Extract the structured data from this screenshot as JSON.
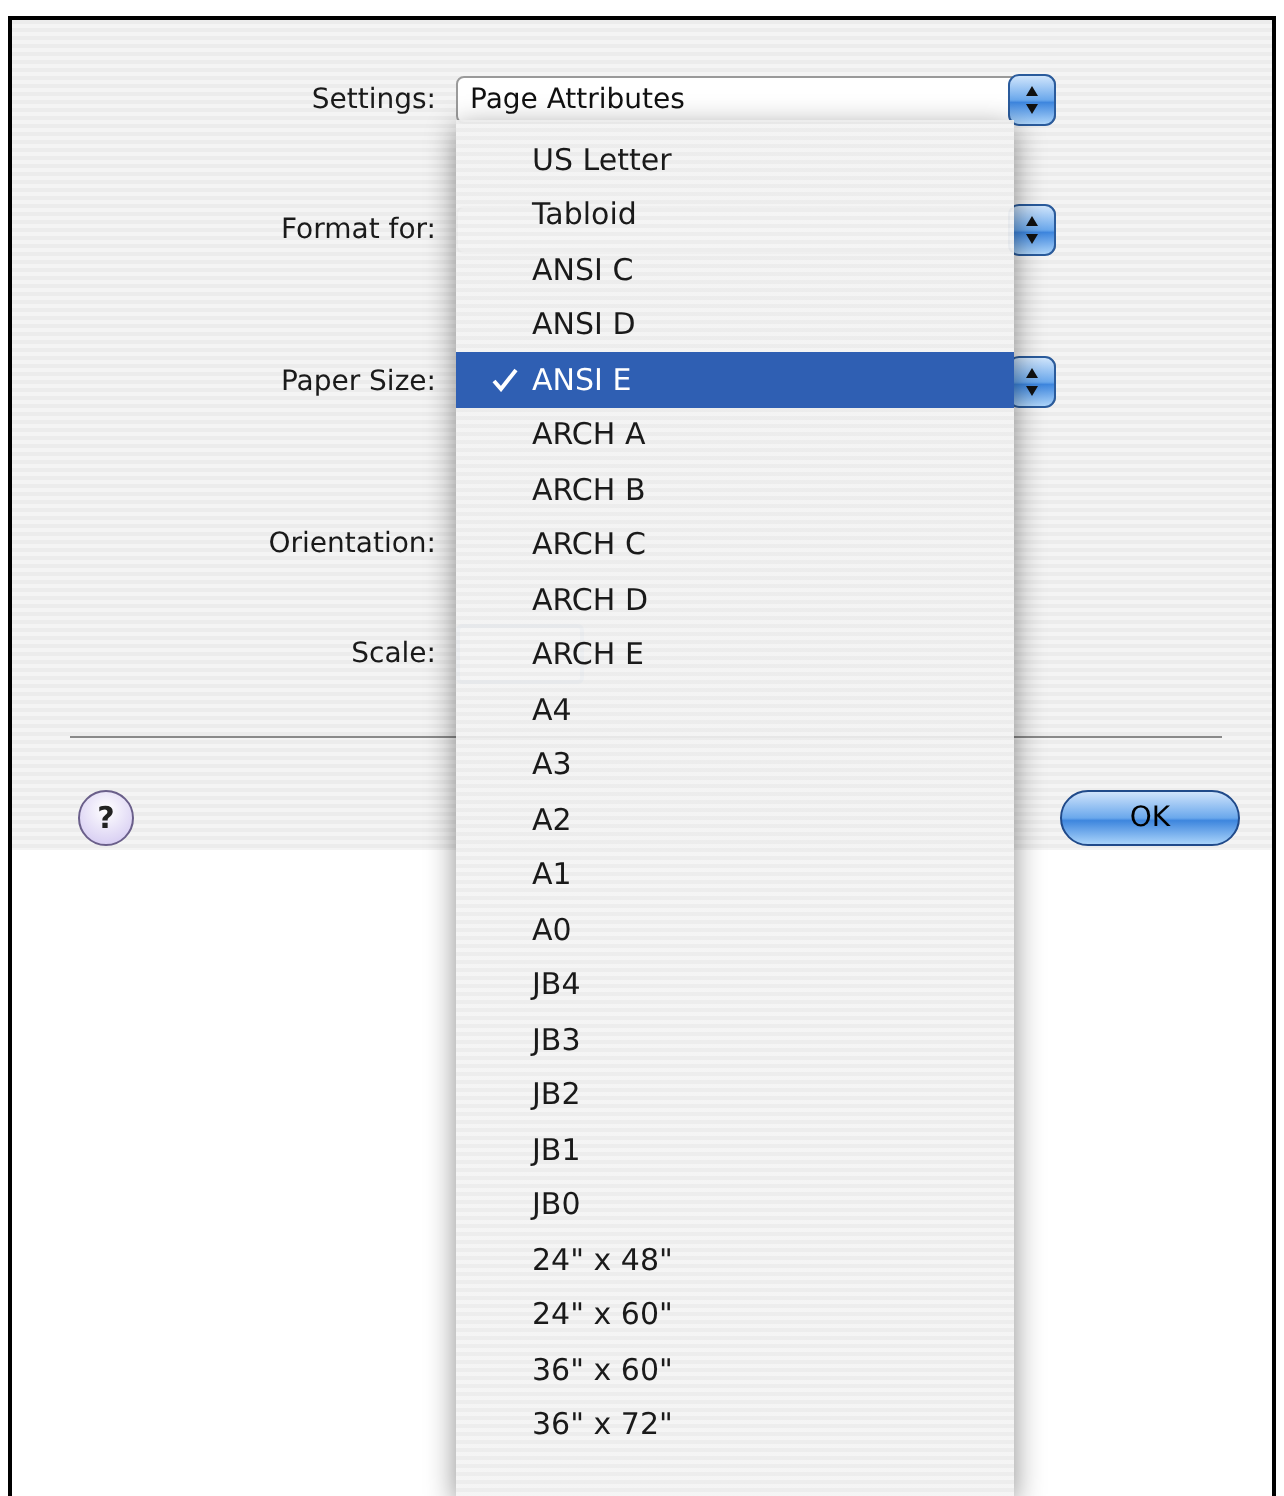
{
  "dialog": {
    "rows": [
      {
        "label": "Settings:",
        "kind": "popup",
        "value": "Page Attributes"
      },
      {
        "label": "Format for:",
        "kind": "popup"
      },
      {
        "label": "Paper Size:",
        "kind": "popup"
      },
      {
        "label": "Orientation:",
        "kind": "blank"
      },
      {
        "label": "Scale:",
        "kind": "field"
      }
    ],
    "help": "?",
    "buttons": [
      {
        "label": "OK",
        "kind": "default"
      }
    ]
  },
  "menu": {
    "items": [
      {
        "label": "US Letter",
        "selected": false
      },
      {
        "label": "Tabloid",
        "selected": false
      },
      {
        "label": "ANSI C",
        "selected": false
      },
      {
        "label": "ANSI D",
        "selected": false
      },
      {
        "label": "ANSI E",
        "selected": true
      },
      {
        "label": "ARCH A",
        "selected": false
      },
      {
        "label": "ARCH B",
        "selected": false
      },
      {
        "label": "ARCH C",
        "selected": false
      },
      {
        "label": "ARCH D",
        "selected": false
      },
      {
        "label": "ARCH E",
        "selected": false
      },
      {
        "label": "A4",
        "selected": false
      },
      {
        "label": "A3",
        "selected": false
      },
      {
        "label": "A2",
        "selected": false
      },
      {
        "label": "A1",
        "selected": false
      },
      {
        "label": "A0",
        "selected": false
      },
      {
        "label": "JB4",
        "selected": false
      },
      {
        "label": "JB3",
        "selected": false
      },
      {
        "label": "JB2",
        "selected": false
      },
      {
        "label": "JB1",
        "selected": false
      },
      {
        "label": "JB0",
        "selected": false
      },
      {
        "label": "24\" x 48\"",
        "selected": false
      },
      {
        "label": "24\" x 60\"",
        "selected": false
      },
      {
        "label": "36\" x 60\"",
        "selected": false
      },
      {
        "label": "36\" x 72\"",
        "selected": false
      }
    ]
  }
}
